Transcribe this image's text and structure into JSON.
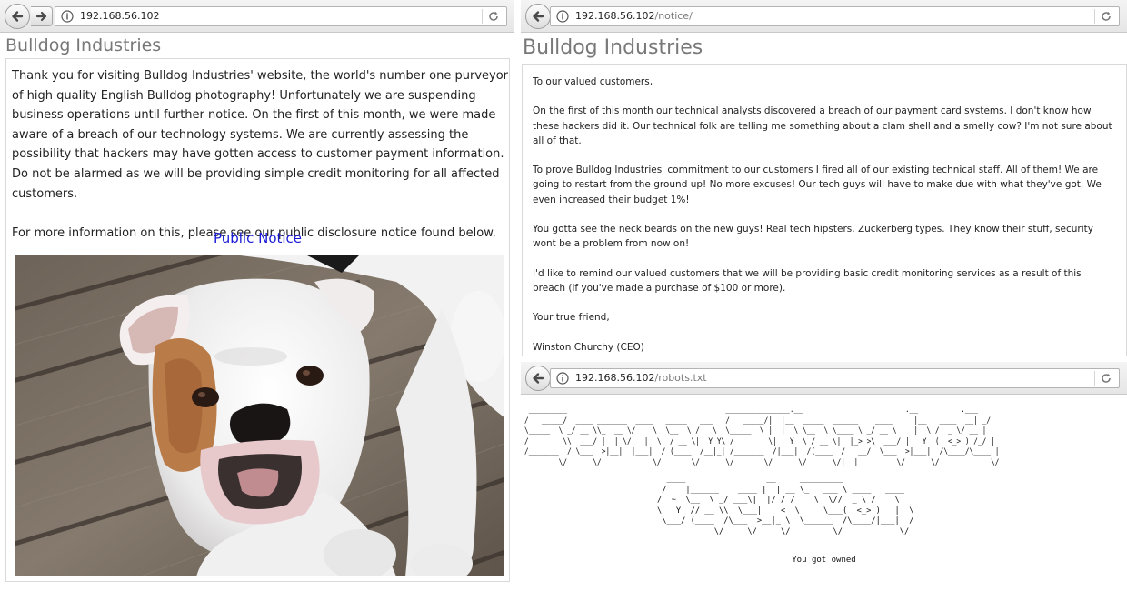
{
  "left": {
    "url": {
      "host": "192.168.56.102",
      "path": ""
    },
    "site_title": "Bulldog Industries",
    "paragraphs": [
      "Thank you for visiting Bulldog Industries' website, the world's number one purveyor of high quality English Bulldog photography! Unfortunately we are suspending business operations until further notice. On the first of this month, we were made aware of a breach of our technology systems. We are currently assessing the possibility that hackers may have gotten access to customer payment information. Do not be alarmed as we will be providing simple credit monitoring for all affected customers.",
      "For more information on this, please see our public disclosure notice found below."
    ],
    "link_label": "Public Notice",
    "photo_icon": "bulldog-photo"
  },
  "right_top": {
    "url": {
      "host": "192.168.56.102",
      "path": "/notice/"
    },
    "site_title": "Bulldog Industries",
    "greeting": "To our valued customers,",
    "paragraphs": [
      "On the first of this month our technical analysts discovered a breach of our payment card systems. I don't know how these hackers did it. Our technical folk are telling me something about a clam shell and a smelly cow? I'm not sure about all of that.",
      "To prove Bulldog Industries' commitment to our customers I fired all of our existing technical staff. All of them! We are going to restart from the ground up! No more excuses! Our tech guys will have to make due with what they've got. We even increased their budget 1%!",
      "You gotta see the neck beards on the new guys! Real tech hipsters. Zuckerberg types. They know their stuff, security wont be a problem from now on!",
      "I'd like to remind our valued customers that we will be providing basic credit monitoring services as a result of this breach (if you've made a purchase of $100 or more)."
    ],
    "closing": "Your true friend,",
    "signature": "Winston Churchy (CEO)"
  },
  "right_bottom": {
    "url": {
      "host": "192.168.56.102",
      "path": "/robots.txt"
    },
    "ascii_banner_1": " _________                                     _______________.__                        .__          .___\n/   _____/  ____ _______  ____   _____   ___   /   _____/|  |__  _____  ______    ____  |  |__   ____  __| _/\n\\_____  \\ _/ __ \\\\_  __ \\/    \\  \\__  \\ /   \\  \\_____  \\ |  |  \\ \\__  \\ \\____ \\ _/ __ \\ |  |  \\ /  _ \\/ __ |\n/        \\\\  ___/ |  | \\/   |  \\  / __ \\|  Y Y\\ /        \\|   Y  \\ / __ \\|  |_> >\\  ___/ |   Y  (  <_> ) /_/ |\n/_______  / \\___  >|__|  |___|  / (____  /__|_| /_______  /|___|  /(____  /   __/  \\___  >|___|  /\\____/\\____ |\n        \\/      \\/            \\/       \\/      \\/       \\/      \\/      \\/|__|         \\/      \\/            \\/",
    "ascii_banner_2": "  ____                 __     _________\n /    |______    ____ |  | __ \\_   ___ \\ ____   ____\n/  ~  \\__  \\ _/ ___\\|  |/ / /    \\  \\//  _ \\ /    \\\n\\   Y  // __ \\\\  \\___|    <  \\     \\___(  <_> )   |  \\\n \\___/ (____  /\\___  >__|_ \\  \\______  /\\____/|___|  /\n            \\/     \\/     \\/         \\/            \\/",
    "owned_text": "You got owned"
  }
}
